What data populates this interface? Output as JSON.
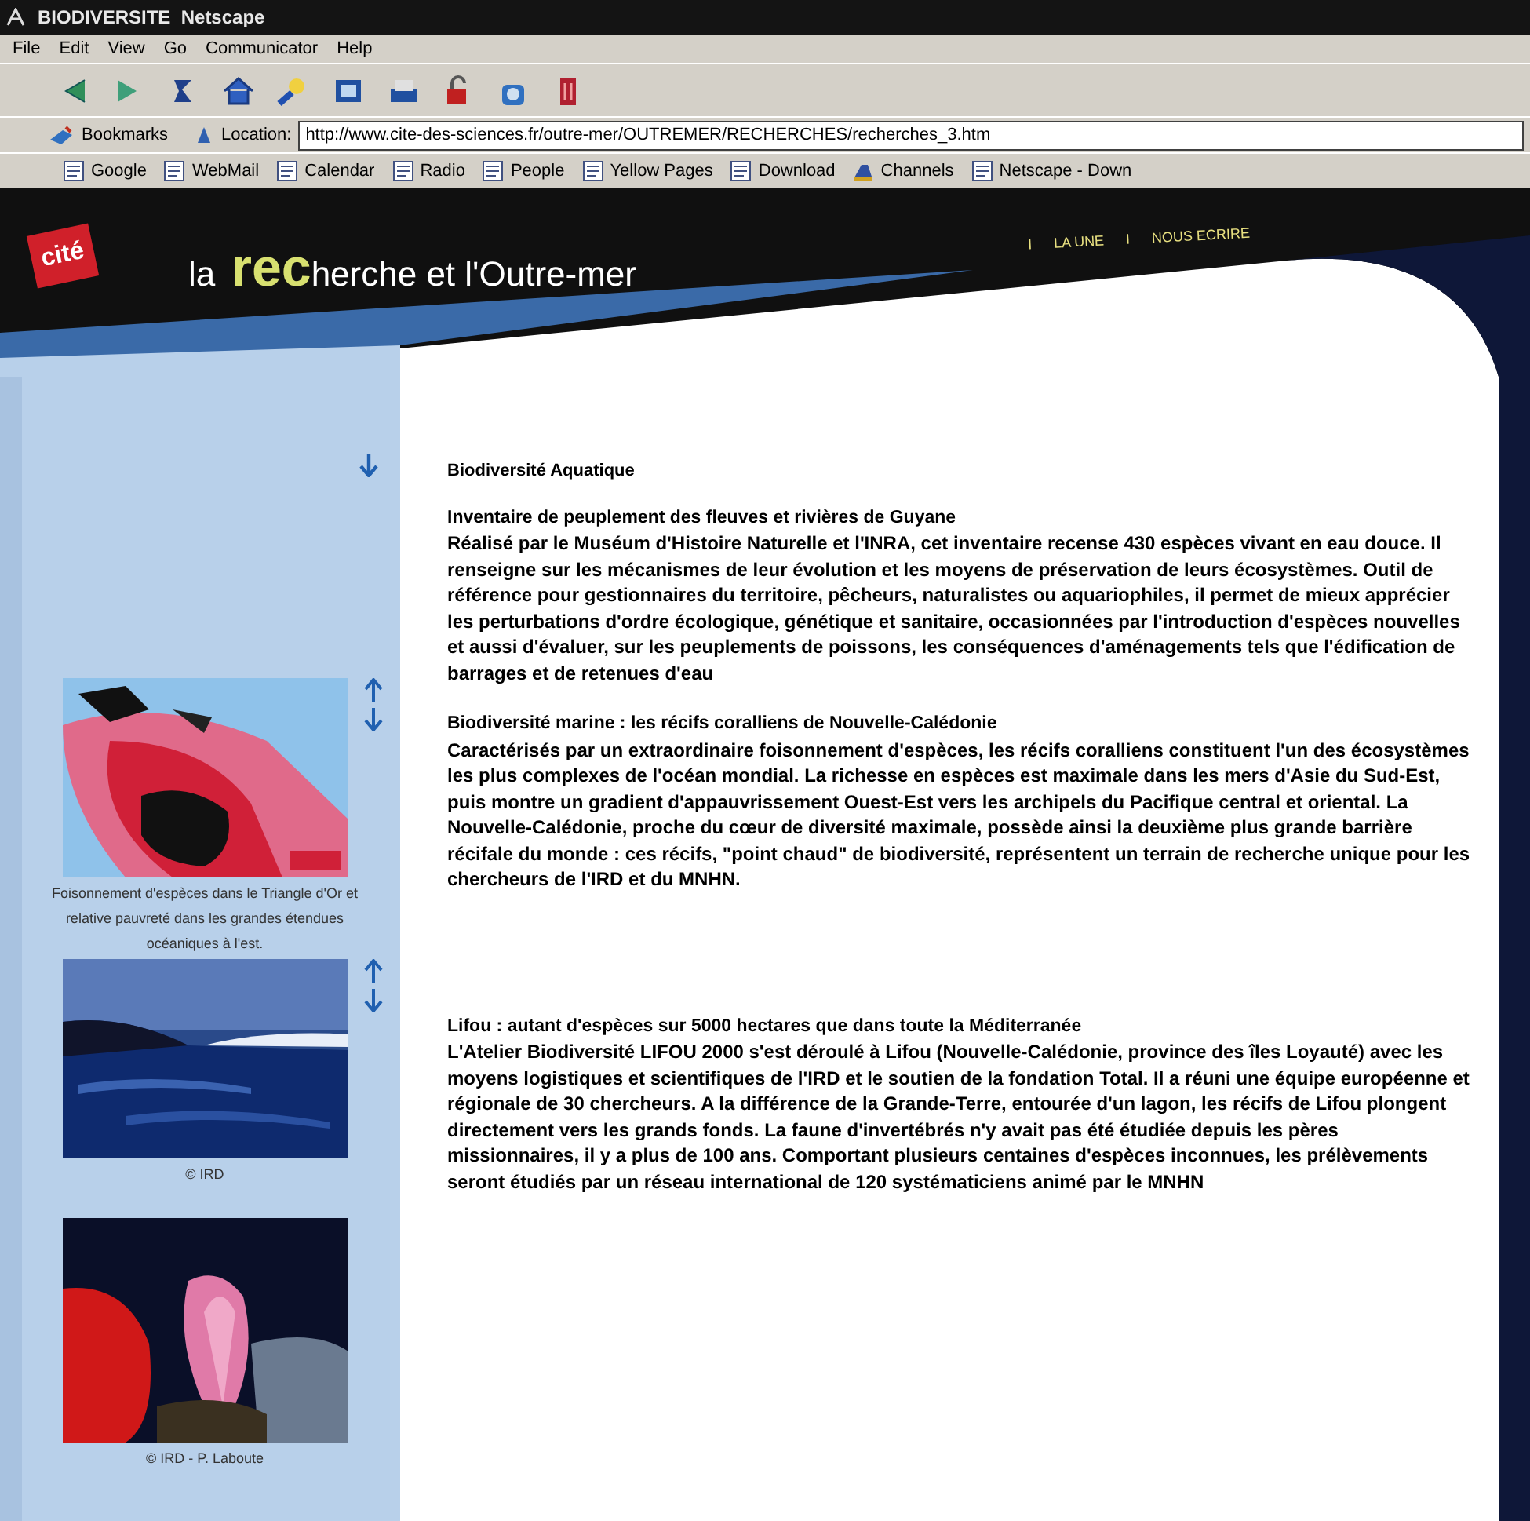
{
  "window": {
    "title": "BIODIVERSITE  Netscape"
  },
  "menu": [
    "File",
    "Edit",
    "View",
    "Go",
    "Communicator",
    "Help"
  ],
  "location_bar": {
    "bookmarks": "Bookmarks",
    "label": "Location:",
    "url": "http://www.cite-des-sciences.fr/outre-mer/OUTREMER/RECHERCHES/recherches_3.htm"
  },
  "personal_toolbar": [
    {
      "label": "Google",
      "kind": "page"
    },
    {
      "label": "WebMail",
      "kind": "page"
    },
    {
      "label": "Calendar",
      "kind": "page"
    },
    {
      "label": "Radio",
      "kind": "page"
    },
    {
      "label": "People",
      "kind": "page"
    },
    {
      "label": "Yellow Pages",
      "kind": "page"
    },
    {
      "label": "Download",
      "kind": "page"
    },
    {
      "label": "Channels",
      "kind": "channels"
    },
    {
      "label": "Netscape - Down",
      "kind": "page"
    }
  ],
  "page": {
    "logo": "cité",
    "banner_title": "la **rec**herche et l'Outre-mer",
    "nav": [
      {
        "separator": "I",
        "label": "LA UNE"
      },
      {
        "separator": "I",
        "label": "NOUS ECRIRE"
      }
    ],
    "figures": [
      {
        "caption": "Foisonnement d'espèces dans le Triangle d'Or et relative pauvreté dans les grandes étendues océaniques à l'est."
      },
      {
        "caption": "© IRD"
      },
      {
        "caption": "© IRD - P. Laboute"
      }
    ],
    "heading": "Biodiversité Aquatique",
    "sections": [
      {
        "title": "Inventaire de peuplement des fleuves et rivières de Guyane",
        "text": "Réalisé par le Muséum d'Histoire Naturelle et l'INRA, cet inventaire recense 430 espèces vivant en eau douce. Il renseigne sur les mécanismes de leur évolution et les moyens de préservation de leurs écosystèmes. Outil de référence pour gestionnaires du territoire, pêcheurs, naturalistes ou aquariophiles, il permet de mieux apprécier les perturbations d'ordre écologique, génétique et sanitaire, occasionnées par l'introduction d'espèces nouvelles et aussi d'évaluer, sur les peuplements de poissons, les conséquences d'aménagements tels que l'édification de barrages et de retenues d'eau"
      },
      {
        "title": "Biodiversité marine : les récifs coralliens de Nouvelle-Calédonie",
        "text": "Caractérisés par un extraordinaire foisonnement d'espèces, les récifs coralliens constituent l'un des écosystèmes les plus complexes de l'océan mondial. La richesse en espèces est maximale dans les mers d'Asie du Sud-Est, puis montre un gradient d'appauvrissement Ouest-Est vers les archipels du Pacifique central et oriental. La Nouvelle-Calédonie, proche du cœur de diversité maximale, possède ainsi la deuxième plus grande barrière récifale du monde : ces récifs, \"point chaud\" de biodiversité, représentent un terrain de recherche unique pour les chercheurs de l'IRD et du MNHN."
      },
      {
        "title": "Lifou : autant d'espèces sur 5000 hectares que dans toute la Méditerranée",
        "text": "L'Atelier Biodiversité LIFOU 2000 s'est déroulé à Lifou (Nouvelle-Calédonie, province des îles Loyauté) avec les moyens logistiques et scientifiques de l'IRD et le soutien de la fondation Total. Il a réuni une équipe européenne et régionale de 30 chercheurs. A la différence de la Grande-Terre, entourée d'un lagon, les récifs de Lifou plongent directement vers les grands fonds. La faune d'invertébrés n'y avait pas été étudiée depuis les pères missionnaires, il y a plus de 100 ans. Comportant plusieurs centaines d'espèces inconnues, les prélèvements seront étudiés par un réseau international de 120 systématiciens animé par le MNHN"
      }
    ]
  }
}
